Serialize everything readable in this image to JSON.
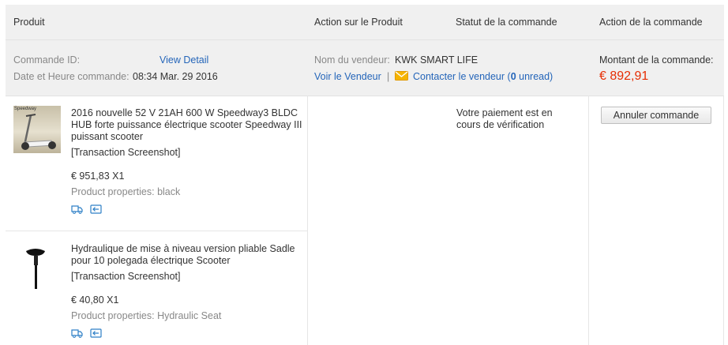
{
  "header": {
    "col_product": "Produit",
    "col_product_action": "Action sur le Produit",
    "col_order_status": "Statut de la commande",
    "col_order_action": "Action de la commande"
  },
  "order": {
    "id_label": "Commande ID:",
    "view_detail": "View Detail",
    "date_label": "Date et Heure commande:",
    "date_value": "08:34 Mar. 29 2016",
    "seller_label": "Nom du vendeur:",
    "seller_name": "KWK SMART LIFE",
    "view_seller": "Voir le Vendeur",
    "separator": "|",
    "contact_seller": "Contacter le vendeur",
    "unread_open": "(",
    "unread_count": "0",
    "unread_close": " unread)",
    "amount_label": "Montant de la commande:",
    "amount_value": "€ 892,91",
    "status": "Votre paiement est en cours de vérification",
    "cancel_button": "Annuler commande"
  },
  "products": [
    {
      "title_lines": [
        "2016 nouvelle 52 V 21AH 600 W Speedway3 BLDC",
        "HUB forte puissance électrique scooter Speedway III",
        "puissant scooter"
      ],
      "screenshot_link": "[Transaction Screenshot]",
      "price": "€ 951,83 X1",
      "properties": "Product properties: black",
      "thumb_label": "Speedway"
    },
    {
      "title_lines": [
        "Hydraulique de mise à niveau version pliable Sadle",
        "pour 10 polegada électrique Scooter"
      ],
      "screenshot_link": "[Transaction Screenshot]",
      "price": "€ 40,80 X1",
      "properties": "Product properties: Hydraulic Seat"
    }
  ],
  "colors": {
    "link": "#2465b9",
    "price_red": "#e62e04",
    "header_bg": "#f0f0f0"
  }
}
